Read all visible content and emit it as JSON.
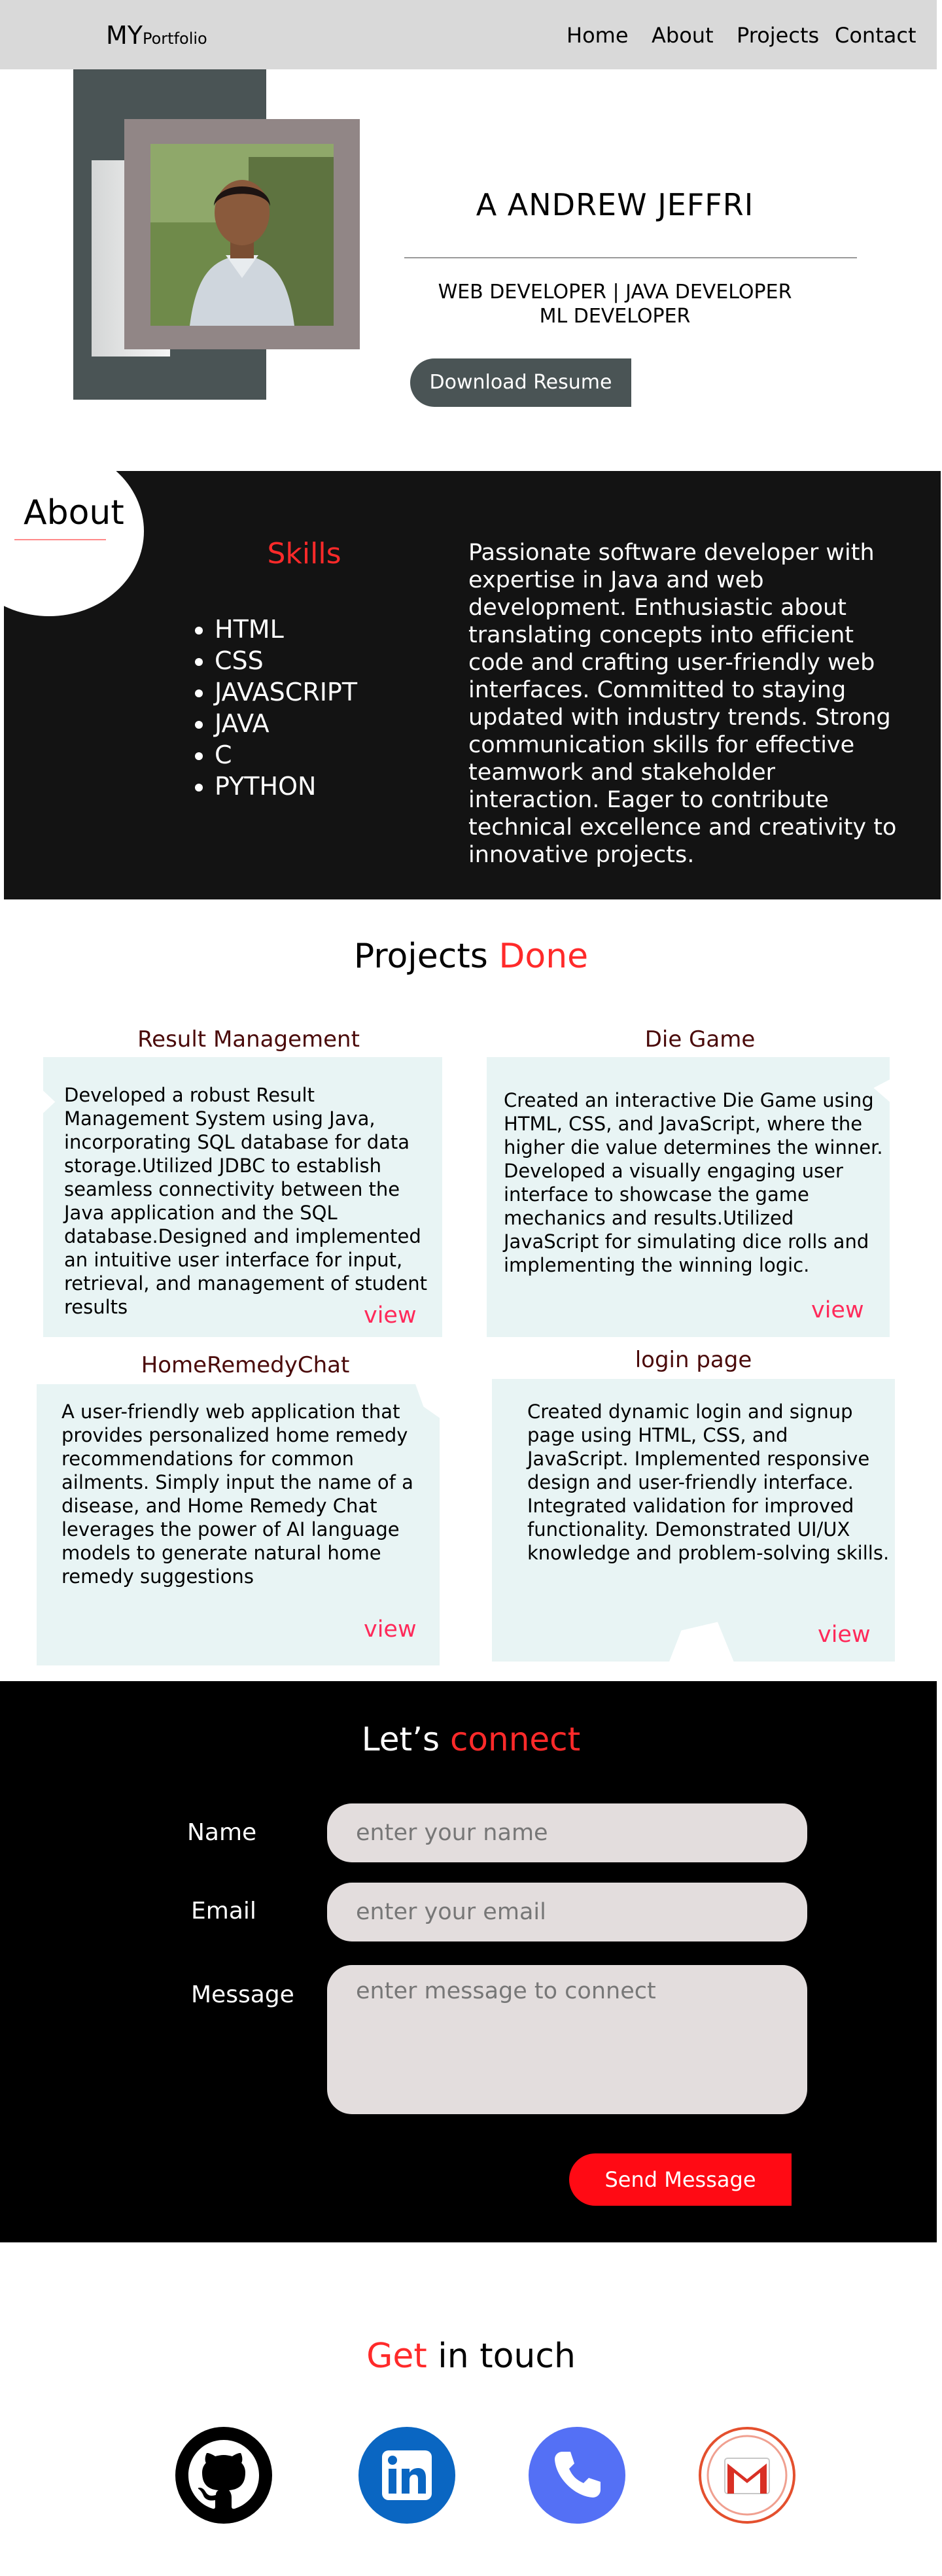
{
  "nav": {
    "logo_main": "MY",
    "logo_sub": "Portfolio",
    "links": [
      "Home",
      "About",
      "Projects",
      "Contact"
    ]
  },
  "hero": {
    "name": "A ANDREW JEFFRI",
    "roles_line1": "WEB DEVELOPER | JAVA DEVELOPER",
    "roles_line2": "ML DEVELOPER",
    "resume_button": "Download Resume"
  },
  "about": {
    "title": "About",
    "skills_title": "Skills",
    "skills": [
      "HTML",
      "CSS",
      "JAVASCRIPT",
      "JAVA",
      "C",
      "PYTHON"
    ],
    "description": "Passionate software developer with expertise in Java and web development. Enthusiastic about translating concepts into efficient code and crafting user-friendly web interfaces. Committed to staying updated with industry trends. Strong communication skills for effective teamwork and stakeholder interaction. Eager to contribute technical excellence and creativity to innovative projects."
  },
  "projects": {
    "title_main": "Projects",
    "title_accent": "Done",
    "items": [
      {
        "title": "Result Management",
        "description": "Developed a robust Result  Management System using Java, incorporating SQL database for data storage.Utilized JDBC to establish seamless connectivity between the Java application and the SQL database.Designed and implemented an intuitive user interface for input, retrieval, and management of student results",
        "link": "view"
      },
      {
        "title": "Die Game",
        "description": "Created an interactive Die Game using HTML, CSS, and JavaScript, where the higher die value determines the winner. Developed a visually engaging user interface to showcase the game mechanics and results.Utilized JavaScript for simulating dice rolls and implementing the winning logic.",
        "link": "view"
      },
      {
        "title": "HomeRemedyChat",
        "description": "A user-friendly web application that provides personalized home remedy recommendations for common ailments.  Simply input the name of a disease, and Home Remedy Chat leverages the power of AI language models to generate natural home remedy suggestions",
        "link": "view"
      },
      {
        "title": "login page",
        "description": "Created dynamic login and signup page using HTML, CSS, and JavaScript. Implemented responsive design and user-friendly interface. Integrated validation for improved functionality. Demonstrated UI/UX knowledge and problem-solving skills.",
        "link": "view"
      }
    ]
  },
  "connect": {
    "title_main": "Let’s",
    "title_accent": "connect",
    "name_label": "Name",
    "name_placeholder": "enter your name",
    "email_label": "Email",
    "email_placeholder": "enter your email",
    "message_label": "Message",
    "message_placeholder": "enter message to connect",
    "send_button": "Send Message"
  },
  "touch": {
    "title_accent": "Get",
    "title_main": "in touch",
    "icons": [
      "github-icon",
      "linkedin-icon",
      "phone-icon",
      "gmail-icon"
    ]
  },
  "colors": {
    "accent": "#ff2a2a",
    "dark_slate": "#4a5455",
    "about_bg": "#131313",
    "card_bg": "#e8f4f4",
    "linkedin": "#0a66c2",
    "phone": "#5470f5"
  }
}
